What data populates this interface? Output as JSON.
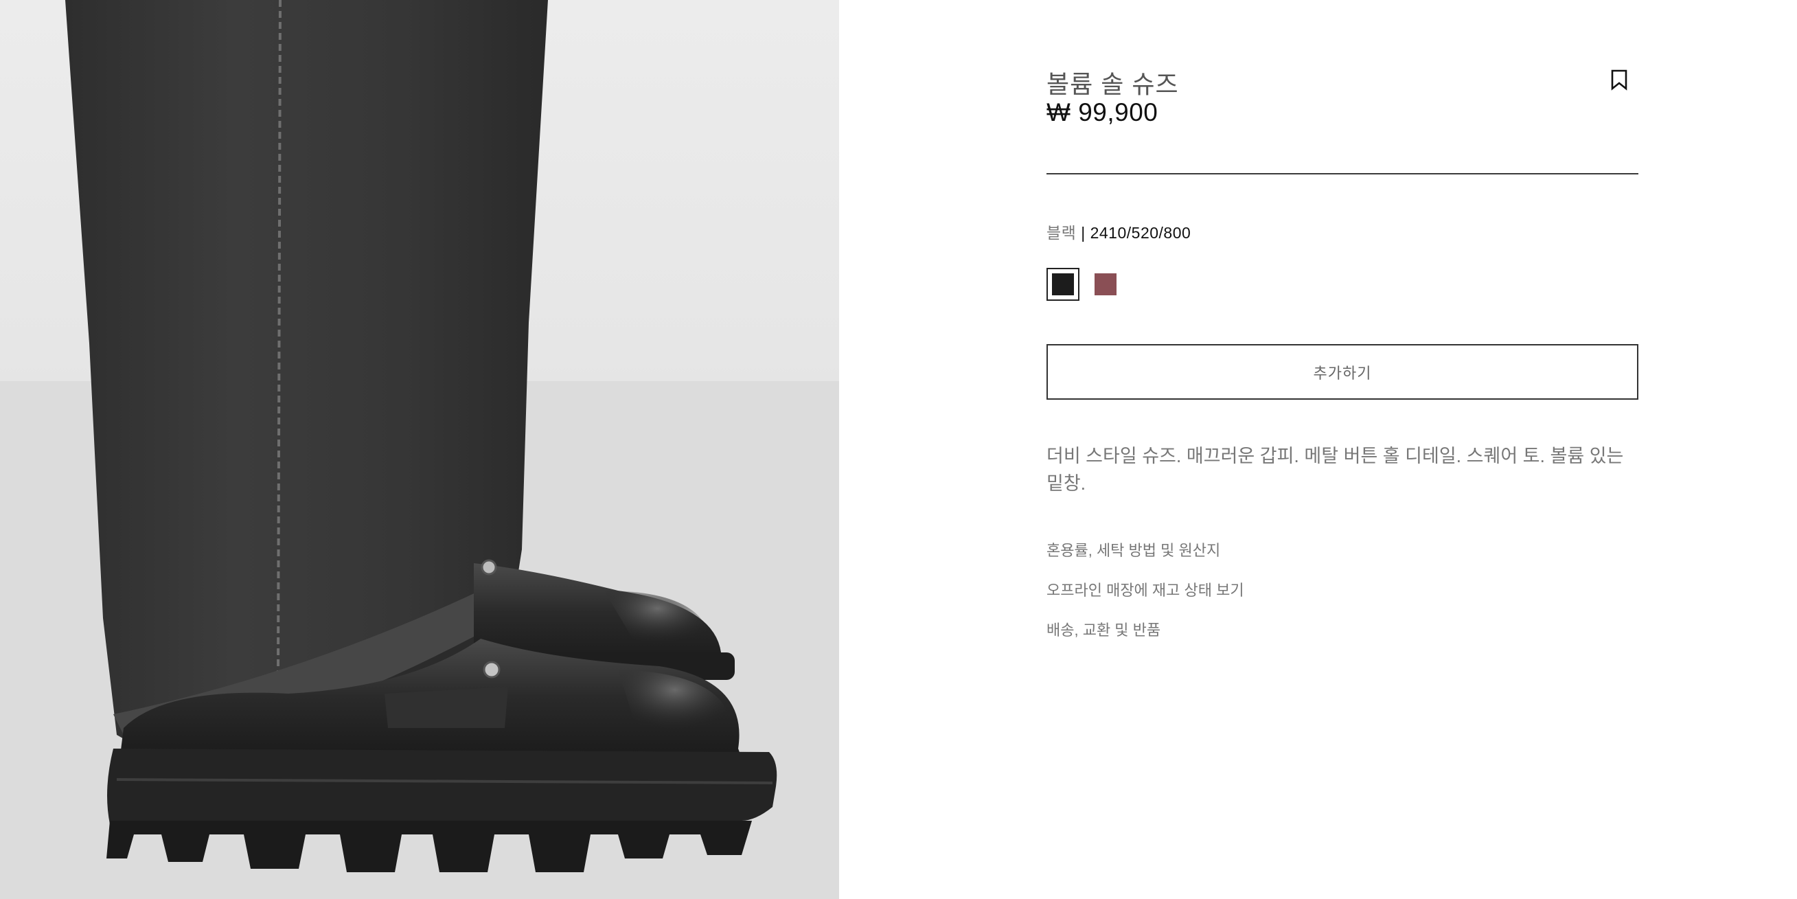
{
  "product": {
    "title": "볼륨 솔 슈즈",
    "price": "₩ 99,900",
    "color_name": "블랙",
    "color_separator": "|",
    "reference": "2410/520/800",
    "swatches": [
      {
        "name": "black",
        "color": "#1c1c1c",
        "selected": true
      },
      {
        "name": "burgundy",
        "color": "#8a4f55",
        "selected": false
      }
    ],
    "add_button_label": "추가하기",
    "description": "더비 스타일 슈즈. 매끄러운 갑피. 메탈 버튼 홀 디테일. 스퀘어 토. 볼륨 있는 밑창.",
    "links": [
      "혼용률, 세탁 방법 및 원산지",
      "오프라인 매장에 재고 상태 보기",
      "배송, 교환 및 반품"
    ],
    "bookmark_icon": "bookmark-icon"
  },
  "image": {
    "subject": "product-photo-shoes"
  }
}
